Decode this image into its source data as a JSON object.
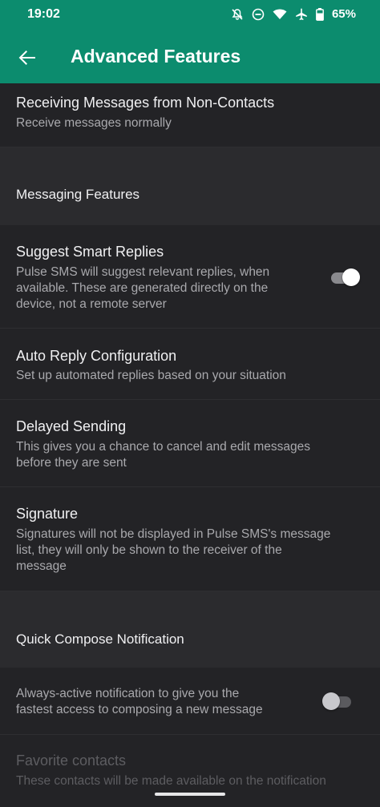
{
  "status_bar": {
    "time": "19:02",
    "battery": "65%",
    "icons": [
      "notifications-off-icon",
      "do-not-disturb-icon",
      "wifi-icon",
      "airplane-icon",
      "battery-icon"
    ]
  },
  "app_bar": {
    "title": "Advanced Features",
    "back_icon": "arrow-back-icon",
    "color": "#0c8c6e"
  },
  "prefs": {
    "non_contacts": {
      "title": "Receiving Messages from Non-Contacts",
      "summary": "Receive messages normally"
    },
    "messaging_category": "Messaging Features",
    "smart_replies": {
      "title": "Suggest Smart Replies",
      "summary_lines": [
        "Pulse SMS will suggest relevant replies, when",
        "available. These are generated directly on the",
        "device, not a remote server"
      ],
      "enabled": true
    },
    "auto_reply": {
      "title": "Auto Reply Configuration",
      "summary": "Set up automated replies based on your situation"
    },
    "delayed_sending": {
      "title": "Delayed Sending",
      "summary_lines": [
        "This gives you a chance to cancel and edit messages",
        "before they are sent"
      ]
    },
    "signature": {
      "title": "Signature",
      "summary_lines": [
        "Signatures will not be displayed in Pulse SMS's message",
        "list, they will only be shown to the receiver of the",
        "message"
      ]
    },
    "quick_compose_category": "Quick Compose Notification",
    "quick_compose": {
      "summary_lines": [
        "Always-active notification to give you the",
        "fastest access to composing a new message"
      ],
      "enabled": false
    },
    "favorite_contacts": {
      "title": "Favorite contacts",
      "summary": "These contacts will be made available on the notification",
      "disabled": true
    }
  }
}
